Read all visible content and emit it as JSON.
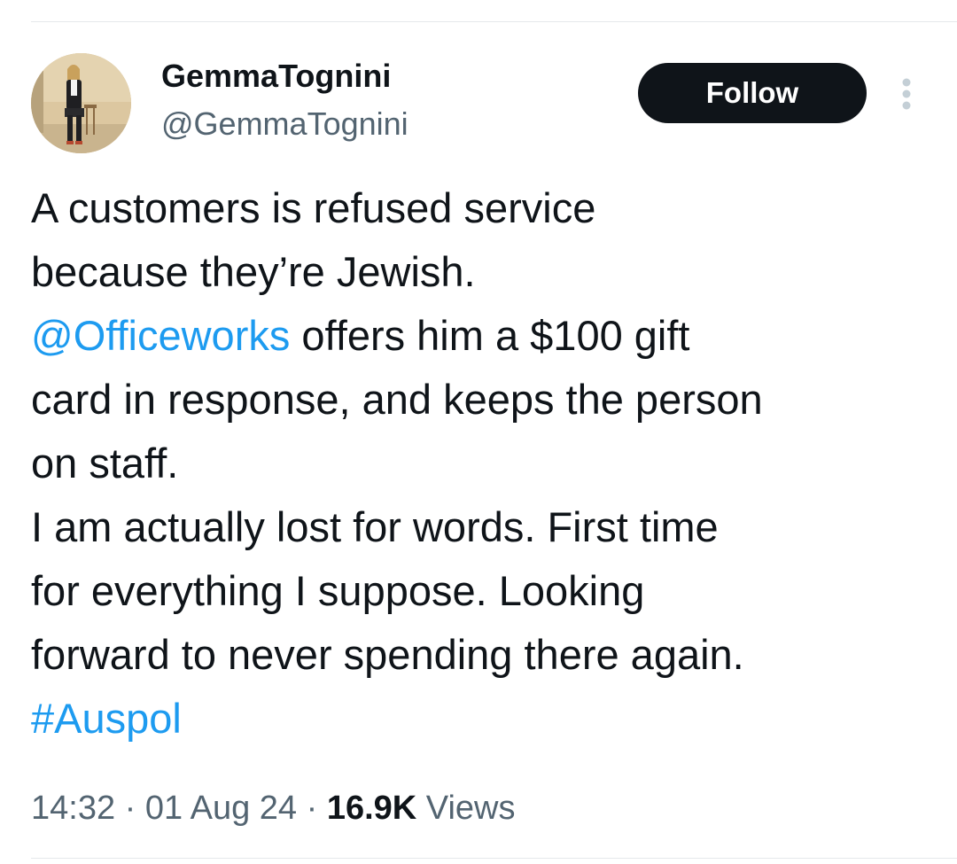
{
  "author": {
    "display_name": "GemmaTognini",
    "handle": "@GemmaTognini"
  },
  "actions": {
    "follow_label": "Follow",
    "more_icon": "more-vertical-icon"
  },
  "tweet": {
    "lines": {
      "l1": "A customers is refused service",
      "l2": "because they’re Jewish.",
      "l3_mention": "@Officeworks",
      "l3_rest": " offers him a $100 gift",
      "l4": "card in response, and keeps the person",
      "l5": "on staff.",
      "l6": "I am actually lost for words.  First time",
      "l7": "for everything I suppose. Looking",
      "l8": "forward to never spending there again.",
      "l9_hashtag": "#Auspol"
    }
  },
  "meta": {
    "time": "14:32",
    "separator": " · ",
    "date": "01 Aug 24",
    "views_count": "16.9K",
    "views_label": " Views"
  },
  "colors": {
    "link": "#1d9bf0",
    "text": "#0f1419",
    "secondary": "#536471",
    "follow_bg": "#0f1419"
  }
}
